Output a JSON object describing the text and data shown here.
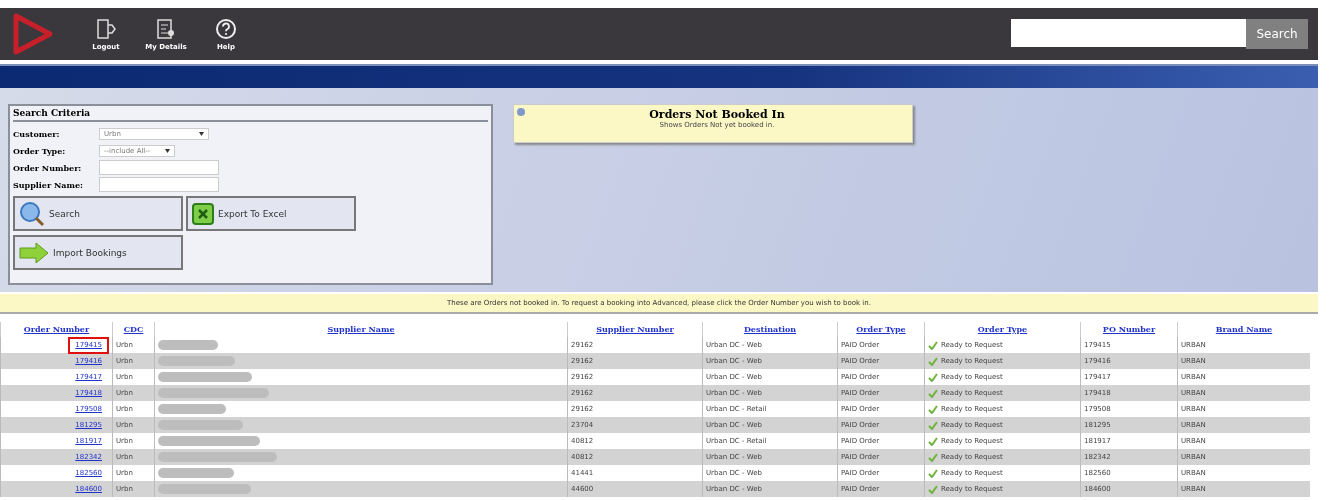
{
  "toolbar": {
    "items": [
      {
        "label": "Logout",
        "kind": "logout"
      },
      {
        "label": "My Details",
        "kind": "details"
      },
      {
        "label": "Help",
        "kind": "help"
      }
    ],
    "search_button": "Search"
  },
  "search_criteria": {
    "title": "Search Criteria",
    "fields": [
      {
        "label": "Customer:",
        "kind": "select",
        "value": "Urbn"
      },
      {
        "label": "Order Type:",
        "kind": "select",
        "value": "--include All--"
      },
      {
        "label": "Order Number:",
        "kind": "input"
      },
      {
        "label": "Supplier Name:",
        "kind": "input"
      }
    ],
    "buttons": [
      {
        "label": "Search",
        "kind": "search"
      },
      {
        "label": "Export To Excel",
        "kind": "excel"
      },
      {
        "label": "Import Bookings",
        "kind": "import"
      }
    ]
  },
  "notice": {
    "title": "Orders Not Booked In",
    "subtitle": "Shows Orders Not yet booked in."
  },
  "info_bar": "These are Orders not booked in. To request a booking into Advanced, please click the Order Number you wish to book in.",
  "table": {
    "columns": [
      "Order Number",
      "CDC",
      "Supplier Name",
      "Supplier Number",
      "Destination",
      "Order Type",
      "Order Type",
      "PO Number",
      "Brand Name"
    ],
    "rows": [
      {
        "order_number": "179415",
        "cdc": "Urbn",
        "supplier_number": "29162",
        "destination": "Urban DC - Web",
        "order_type": "PAID Order",
        "status": "Ready to Request",
        "po_number": "179415",
        "brand": "URBAN",
        "highlighted": true
      },
      {
        "order_number": "179416",
        "cdc": "Urbn",
        "supplier_number": "29162",
        "destination": "Urban DC - Web",
        "order_type": "PAID Order",
        "status": "Ready to Request",
        "po_number": "179416",
        "brand": "URBAN",
        "highlighted": false
      },
      {
        "order_number": "179417",
        "cdc": "Urbn",
        "supplier_number": "29162",
        "destination": "Urban DC - Web",
        "order_type": "PAID Order",
        "status": "Ready to Request",
        "po_number": "179417",
        "brand": "URBAN",
        "highlighted": false
      },
      {
        "order_number": "179418",
        "cdc": "Urbn",
        "supplier_number": "29162",
        "destination": "Urban DC - Web",
        "order_type": "PAID Order",
        "status": "Ready to Request",
        "po_number": "179418",
        "brand": "URBAN",
        "highlighted": false
      },
      {
        "order_number": "179508",
        "cdc": "Urbn",
        "supplier_number": "29162",
        "destination": "Urban DC - Retail",
        "order_type": "PAID Order",
        "status": "Ready to Request",
        "po_number": "179508",
        "brand": "URBAN",
        "highlighted": false
      },
      {
        "order_number": "181295",
        "cdc": "Urbn",
        "supplier_number": "23704",
        "destination": "Urban DC - Web",
        "order_type": "PAID Order",
        "status": "Ready to Request",
        "po_number": "181295",
        "brand": "URBAN",
        "highlighted": false
      },
      {
        "order_number": "181917",
        "cdc": "Urbn",
        "supplier_number": "40812",
        "destination": "Urban DC - Retail",
        "order_type": "PAID Order",
        "status": "Ready to Request",
        "po_number": "181917",
        "brand": "URBAN",
        "highlighted": false
      },
      {
        "order_number": "182342",
        "cdc": "Urbn",
        "supplier_number": "40812",
        "destination": "Urban DC - Web",
        "order_type": "PAID Order",
        "status": "Ready to Request",
        "po_number": "182342",
        "brand": "URBAN",
        "highlighted": false
      },
      {
        "order_number": "182560",
        "cdc": "Urbn",
        "supplier_number": "41441",
        "destination": "Urban DC - Web",
        "order_type": "PAID Order",
        "status": "Ready to Request",
        "po_number": "182560",
        "brand": "URBAN",
        "highlighted": false
      },
      {
        "order_number": "184600",
        "cdc": "Urbn",
        "supplier_number": "44600",
        "destination": "Urban DC - Web",
        "order_type": "PAID Order",
        "status": "Ready to Request",
        "po_number": "184600",
        "brand": "URBAN",
        "highlighted": false
      }
    ]
  }
}
